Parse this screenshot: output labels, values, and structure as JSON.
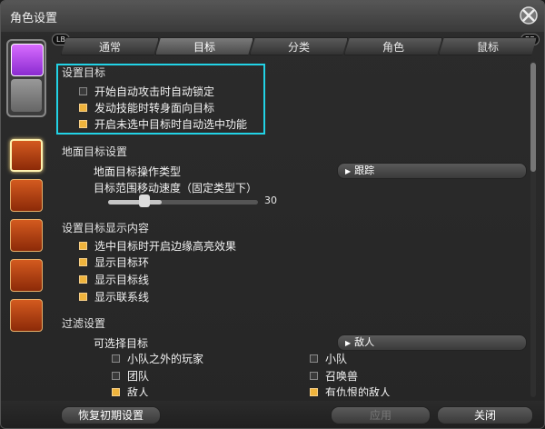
{
  "window": {
    "title": "角色设置"
  },
  "controller": {
    "lb": "LB",
    "rb": "RB"
  },
  "tabs": [
    {
      "label": "通常"
    },
    {
      "label": "目标"
    },
    {
      "label": "分类"
    },
    {
      "label": "角色"
    },
    {
      "label": "鼠标"
    }
  ],
  "sections": {
    "set_target": {
      "heading": "设置目标",
      "options": [
        {
          "label": "开始自动攻击时自动锁定",
          "checked": false
        },
        {
          "label": "发动技能时转身面向目标",
          "checked": true
        },
        {
          "label": "开启未选中目标时自动选中功能",
          "checked": true
        }
      ]
    },
    "ground_target": {
      "heading": "地面目标设置",
      "op_type_label": "地面目标操作类型",
      "op_type_value": "跟踪",
      "speed_label": "目标范围移动速度（固定类型下）",
      "speed_value": "30",
      "speed_fraction": 0.36
    },
    "display_target": {
      "heading": "设置目标显示内容",
      "options": [
        {
          "label": "选中目标时开启边缘高亮效果",
          "checked": true
        },
        {
          "label": "显示目标环",
          "checked": true
        },
        {
          "label": "显示目标线",
          "checked": true
        },
        {
          "label": "显示联系线",
          "checked": true
        }
      ]
    },
    "filter": {
      "heading": "过滤设置",
      "selectable_label": "可选择目标",
      "selectable_value": "敌人",
      "options_left": [
        {
          "label": "小队之外的玩家",
          "checked": false
        },
        {
          "label": "团队",
          "checked": false
        },
        {
          "label": "敌人",
          "checked": true
        }
      ],
      "options_right": [
        {
          "label": "小队",
          "checked": false
        },
        {
          "label": "召唤兽",
          "checked": false
        },
        {
          "label": "有仇恨的敌人",
          "checked": true
        }
      ]
    }
  },
  "footer": {
    "reset": "恢复初期设置",
    "apply": "应用",
    "close": "关闭"
  },
  "colors": {
    "highlight": "#22d3e6",
    "checkbox_on": "#f0b43c"
  }
}
